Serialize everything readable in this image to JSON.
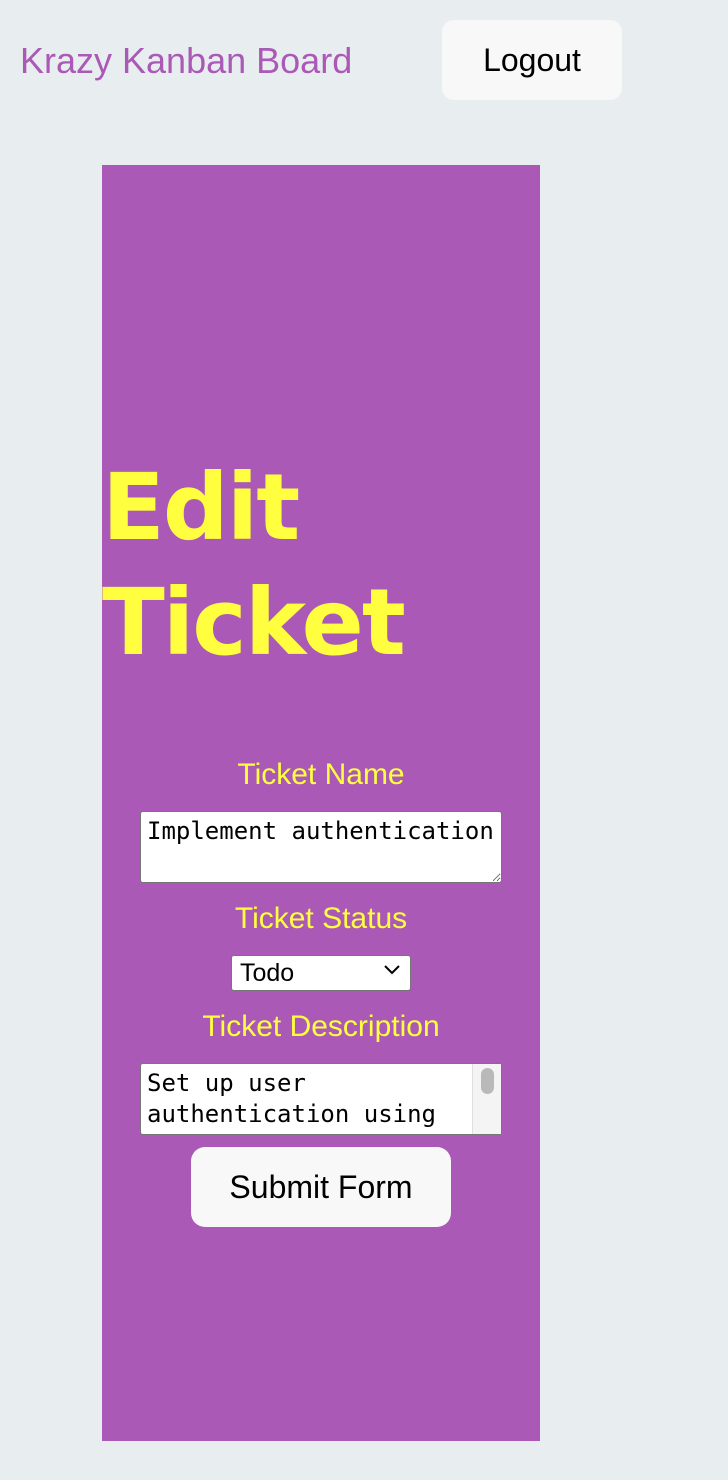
{
  "header": {
    "brand": "Krazy Kanban Board",
    "logout_label": "Logout"
  },
  "form": {
    "title": "Edit Ticket",
    "name_label": "Ticket Name",
    "name_value": "Implement authentication",
    "status_label": "Ticket Status",
    "status_value": "Todo",
    "description_label": "Ticket Description",
    "description_value": "Set up user authentication using",
    "submit_label": "Submit Form"
  },
  "colors": {
    "page_background": "#e8eeef",
    "panel_background": "#ab59b6",
    "accent_text": "#ffff3f",
    "brand_text": "#ab59b6",
    "button_background": "#f8f8f8"
  },
  "icons": {
    "select_arrow": "chevron-down-icon"
  }
}
